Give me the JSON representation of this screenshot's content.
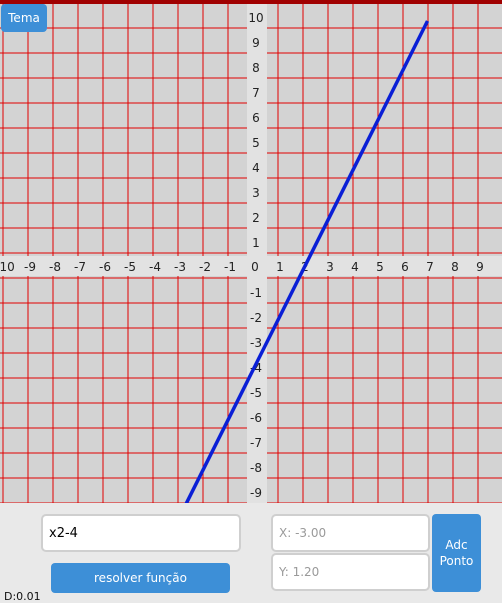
{
  "theme_button": {
    "label": "Tema"
  },
  "graph": {
    "x_range": [
      -10,
      10
    ],
    "y_range": [
      -10,
      10
    ],
    "x_tick_labels": [
      "-10",
      "-9",
      "-8",
      "-7",
      "-6",
      "-5",
      "-4",
      "-3",
      "-2",
      "-1",
      "0",
      "1",
      "2",
      "3",
      "4",
      "5",
      "6",
      "7",
      "8",
      "9"
    ],
    "y_tick_labels": [
      "10",
      "9",
      "8",
      "7",
      "6",
      "5",
      "4",
      "3",
      "2",
      "1",
      "-1",
      "-2",
      "-3",
      "-4",
      "-5",
      "-6",
      "-7",
      "-8",
      "-9"
    ],
    "grid_color": "#e00000",
    "background": "#d3d3d3",
    "curve_color": "#0a1fd6"
  },
  "chart_data": {
    "type": "line",
    "series": [
      {
        "x": [
          -3.1,
          6.9
        ],
        "y": [
          -10.2,
          9.8
        ]
      }
    ],
    "xlim": [
      -10,
      10
    ],
    "ylim": [
      -10,
      10
    ],
    "grid": true
  },
  "function_input": {
    "value": "x2-4"
  },
  "solve_button": {
    "label": "resolver função"
  },
  "x_field": {
    "placeholder": "X: -3.00"
  },
  "y_field": {
    "placeholder": "Y: 1.20"
  },
  "add_point_button": {
    "line1": "Adc",
    "line2": "Ponto"
  },
  "delta_text": "D:0.01"
}
